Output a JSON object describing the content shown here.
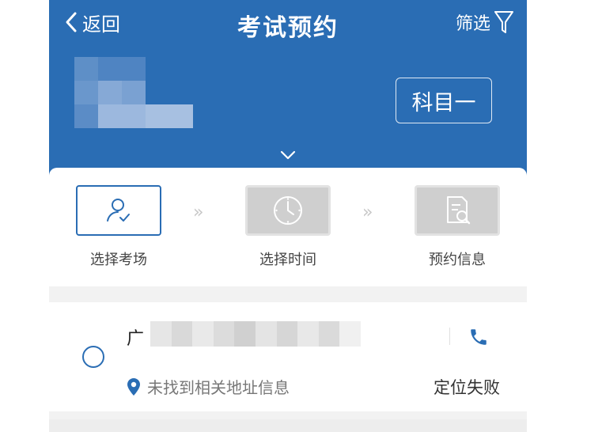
{
  "topbar": {
    "back_label": "返回",
    "title": "考试预约",
    "filter_label": "筛选"
  },
  "header": {
    "subject_label": "科目一"
  },
  "steps": [
    {
      "label": "选择考场",
      "icon": "user-check-icon",
      "active": true
    },
    {
      "label": "选择时间",
      "icon": "clock-icon",
      "active": false
    },
    {
      "label": "预约信息",
      "icon": "document-search-icon",
      "active": false
    }
  ],
  "step_separator": "»",
  "exam_center": {
    "name_visible_char": "广",
    "address_status": "未找到相关地址信息",
    "location_action": "定位失败",
    "selected": false
  },
  "colors": {
    "primary_blue": "#2a6db4",
    "background": "#f2f2f2"
  }
}
